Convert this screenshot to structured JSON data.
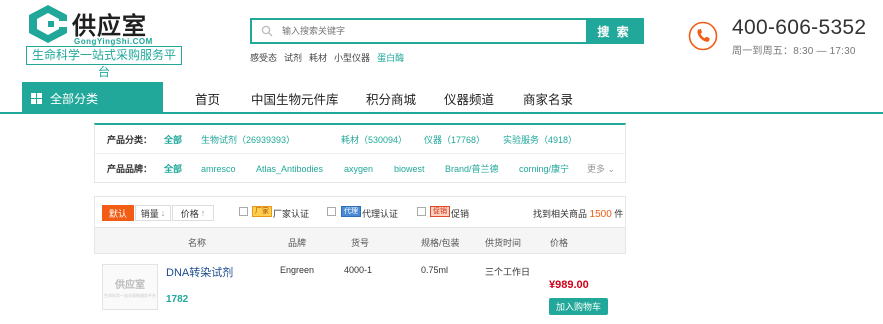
{
  "logo": {
    "title": "供应室",
    "subtitle": "GongYingShi.COM",
    "slogan": "生命科学一站式采购服务平台"
  },
  "search": {
    "placeholder": "输入搜索关键字",
    "button_label": "搜 索",
    "hot_terms": [
      "感受态",
      "试剂",
      "耗材",
      "小型仪器",
      "蛋白酶"
    ],
    "highlight_color": "#21a89a"
  },
  "contact": {
    "phone": "400-606-5352",
    "hours": "周一到周五：8:30 — 17:30"
  },
  "nav": {
    "all_categories": "全部分类",
    "items": [
      "首页",
      "中国生物元件库",
      "积分商城",
      "仪器频道",
      "商家名录"
    ]
  },
  "filters": {
    "category_label": "产品分类：",
    "categories": [
      "全部",
      "生物试剂（26939393）",
      "耗材（530094）",
      "仪器（17768）",
      "实验服务（4918）"
    ],
    "brand_label": "产品品牌：",
    "brands": [
      "全部",
      "amresco",
      "Atlas_Antibodies",
      "axygen",
      "biowest",
      "Brand/普兰德",
      "corning/康宁"
    ],
    "more_label": "更多"
  },
  "sort": {
    "default_label": "默认",
    "sales_label": "销量",
    "price_label": "价格",
    "options": [
      {
        "tag": "厂家",
        "label": "厂家认证"
      },
      {
        "tag": "代理",
        "label": "代理认证"
      },
      {
        "tag": "促销",
        "label": "促销"
      }
    ],
    "found_prefix": "找到相关商品",
    "found_count": "1500",
    "found_suffix": "件"
  },
  "columns": {
    "name": "名称",
    "brand": "品牌",
    "code": "货号",
    "spec": "规格/包装",
    "delivery": "供货时间",
    "price": "价格"
  },
  "products": [
    {
      "thumb_title": "供应室",
      "thumb_sub": "生命科学一站式采购服务平台",
      "name": "DNA转染试剂",
      "id": "1782",
      "brand": "Engreen",
      "code": "4000-1",
      "spec": "0.75ml",
      "delivery": "三个工作日",
      "price": "¥989.00",
      "cart_label": "加入购物车"
    }
  ],
  "colors": {
    "brand": "#21a89a",
    "accent": "#f25c14",
    "price": "#d0021b"
  }
}
